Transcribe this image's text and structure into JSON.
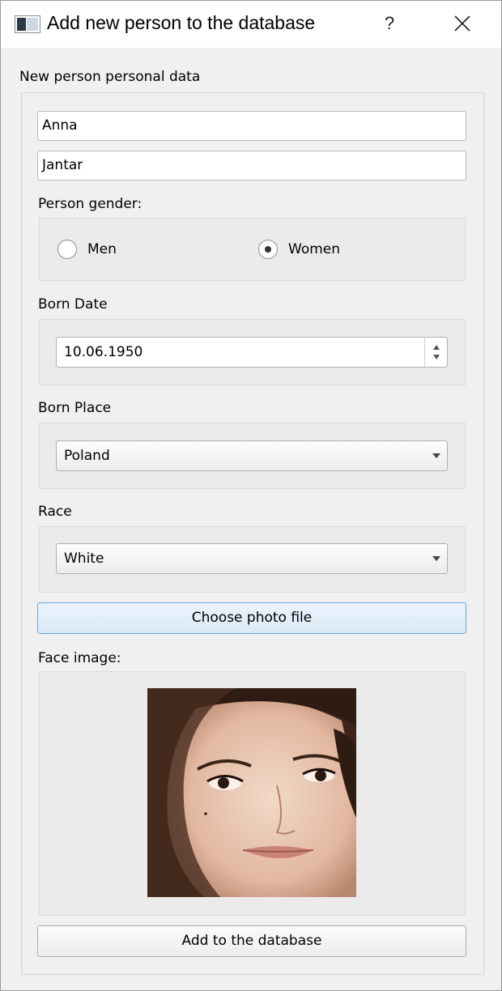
{
  "window": {
    "title": "Add new person to the database",
    "help_label": "?"
  },
  "form": {
    "group_title": "New person personal data",
    "first_name": "Anna",
    "last_name": "Jantar",
    "gender": {
      "label": "Person gender:",
      "options": [
        "Men",
        "Women"
      ],
      "selected": "Women"
    },
    "born_date": {
      "label": "Born Date",
      "value": "10.06.1950"
    },
    "born_place": {
      "label": "Born Place",
      "value": "Poland"
    },
    "race": {
      "label": "Race",
      "value": "White"
    },
    "choose_photo_label": "Choose photo file",
    "face_image_label": "Face image:",
    "add_button_label": "Add to the database"
  },
  "colors": {
    "focus_border": "#6aa6d8",
    "radio_dot": "#333333"
  }
}
